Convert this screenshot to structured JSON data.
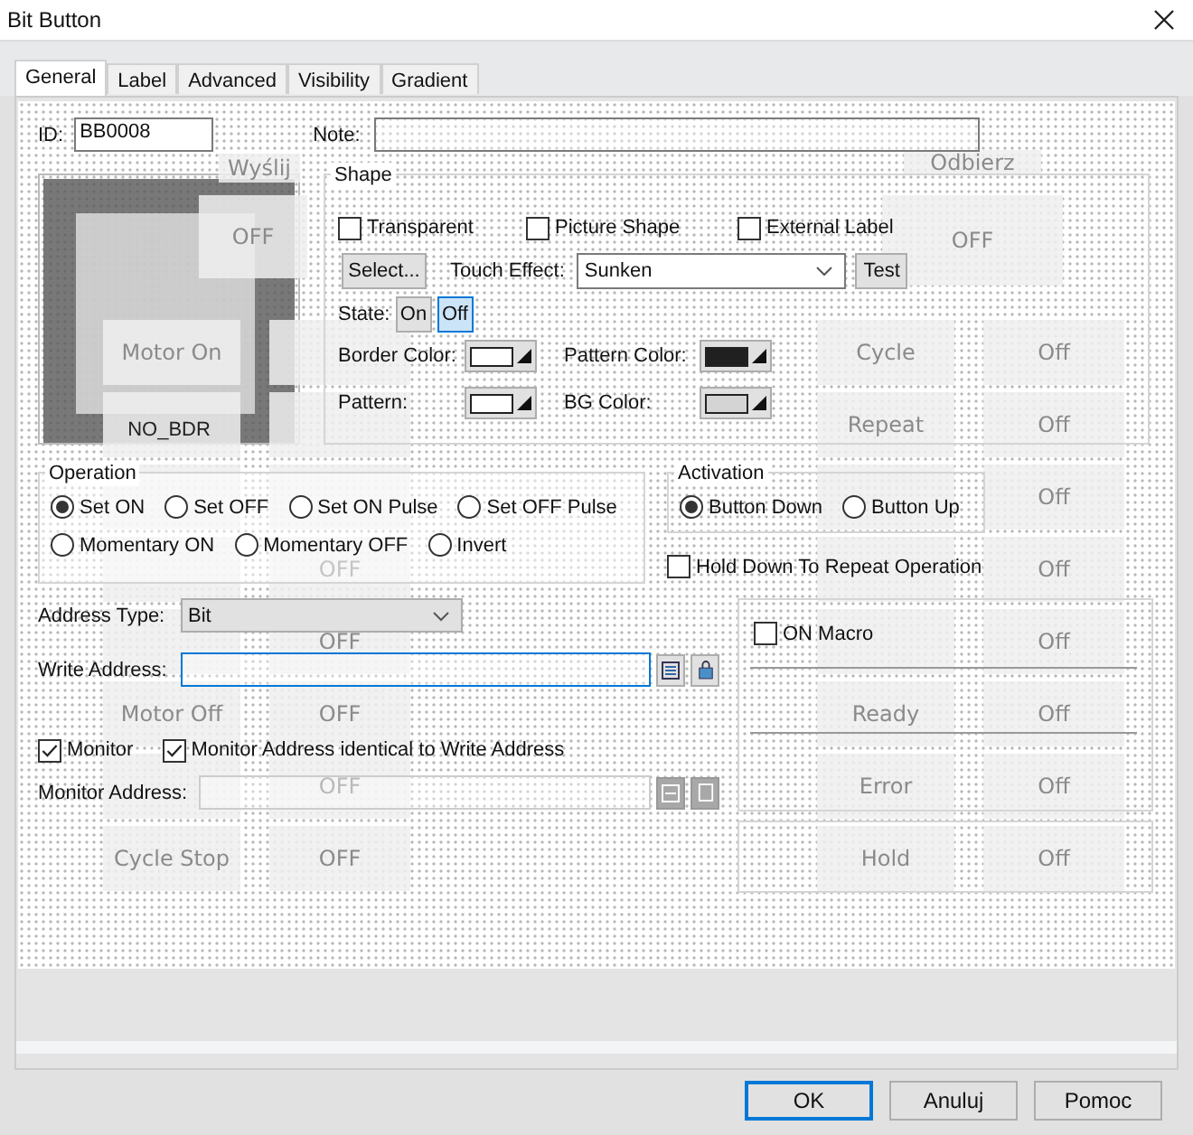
{
  "window": {
    "title": "Bit Button"
  },
  "tabs": [
    {
      "label": "General",
      "selected": true
    },
    {
      "label": "Label",
      "selected": false
    },
    {
      "label": "Advanced",
      "selected": false
    },
    {
      "label": "Visibility",
      "selected": false
    },
    {
      "label": "Gradient",
      "selected": false
    }
  ],
  "id": {
    "label": "ID:",
    "value": "BB0008"
  },
  "note": {
    "label": "Note:"
  },
  "preview": {
    "label": "NO_BDR"
  },
  "shape": {
    "title": "Shape",
    "options": [
      {
        "label": "Transparent",
        "checked": false
      },
      {
        "label": "Picture Shape",
        "checked": false
      },
      {
        "label": "External Label",
        "checked": false
      }
    ],
    "select_button": "Select...",
    "touch_effect": {
      "label": "Touch Effect:",
      "value": "Sunken"
    },
    "test_button": "Test",
    "state": {
      "label": "State:",
      "options": [
        {
          "label": "On",
          "selected": false
        },
        {
          "label": "Off",
          "selected": true
        }
      ]
    },
    "colors": [
      {
        "label": "Border Color:",
        "color": "#ffffff"
      },
      {
        "label": "Pattern Color:",
        "color": "#202020"
      },
      {
        "label": "Pattern:",
        "color": "#ffffff"
      },
      {
        "label": "BG Color:",
        "color": "#d4d4d4"
      }
    ]
  },
  "operation": {
    "title": "Operation",
    "options": [
      {
        "label": "Set ON",
        "selected": true
      },
      {
        "label": "Set OFF",
        "selected": false
      },
      {
        "label": "Set ON Pulse",
        "selected": false
      },
      {
        "label": "Set OFF Pulse",
        "selected": false
      },
      {
        "label": "Momentary ON",
        "selected": false
      },
      {
        "label": "Momentary OFF",
        "selected": false
      },
      {
        "label": "Invert",
        "selected": false
      }
    ]
  },
  "activation": {
    "title": "Activation",
    "options": [
      {
        "label": "Button Down",
        "selected": true
      },
      {
        "label": "Button Up",
        "selected": false
      }
    ]
  },
  "hold_down": {
    "label": "Hold Down To Repeat Operation",
    "checked": false
  },
  "address_type": {
    "label": "Address Type:",
    "value": "Bit"
  },
  "write_address": {
    "label": "Write Address:",
    "disabled": false
  },
  "monitor": {
    "label": "Monitor",
    "checked": true
  },
  "monitor_identical": {
    "label": "Monitor Address identical to Write Address",
    "checked": true
  },
  "monitor_address": {
    "label": "Monitor Address:",
    "disabled": true
  },
  "on_macro": {
    "label": "ON Macro",
    "checked": false
  },
  "background_screen": {
    "top_buttons": [
      "Wyślij",
      "Odbierz",
      "OFF",
      "OFF"
    ],
    "left_rows": [
      {
        "label": "Motor On"
      },
      {},
      {},
      {
        "value": "OFF"
      },
      {
        "value": "OFF"
      },
      {
        "label": "Motor Off",
        "value": "OFF"
      },
      {
        "value": "OFF"
      },
      {
        "label": "Cycle Stop",
        "value": "OFF"
      }
    ],
    "right_rows": [
      {
        "label": "Cycle",
        "value": "Off"
      },
      {
        "label": "Repeat",
        "value": "Off"
      },
      {
        "value": "Off"
      },
      {
        "value": "Off"
      },
      {
        "value": "Off"
      },
      {
        "label": "Ready",
        "value": "Off"
      },
      {
        "label": "Error",
        "value": "Off"
      },
      {
        "label": "Hold",
        "value": "Off"
      }
    ]
  },
  "buttons": [
    "OK",
    "Anuluj",
    "Pomoc"
  ]
}
